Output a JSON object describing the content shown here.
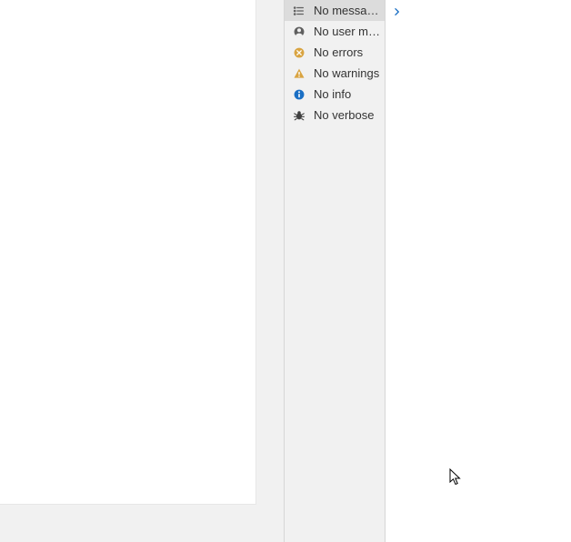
{
  "filters": {
    "items": [
      {
        "label": "No messages"
      },
      {
        "label": "No user me..."
      },
      {
        "label": "No errors"
      },
      {
        "label": "No warnings"
      },
      {
        "label": "No info"
      },
      {
        "label": "No verbose"
      }
    ]
  }
}
